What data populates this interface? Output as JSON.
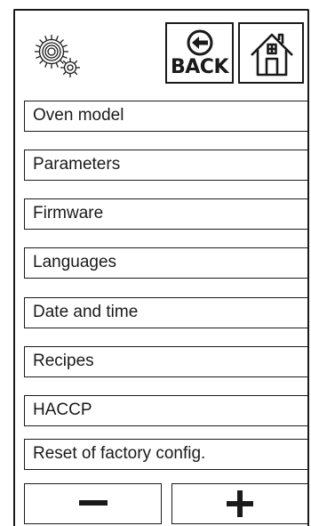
{
  "header": {
    "settings_icon": "settings-gears-icon",
    "back_label": "BACK",
    "back_icon": "arrow-left-circle-icon",
    "home_icon": "home-icon"
  },
  "menu": {
    "items": [
      {
        "label": "Oven model"
      },
      {
        "label": "Parameters"
      },
      {
        "label": "Firmware"
      },
      {
        "label": "Languages"
      },
      {
        "label": "Date and time"
      },
      {
        "label": "Recipes"
      },
      {
        "label": "HACCP"
      },
      {
        "label": "Reset of factory config."
      }
    ]
  },
  "stepper": {
    "minus_icon": "minus-icon",
    "plus_icon": "plus-icon"
  }
}
